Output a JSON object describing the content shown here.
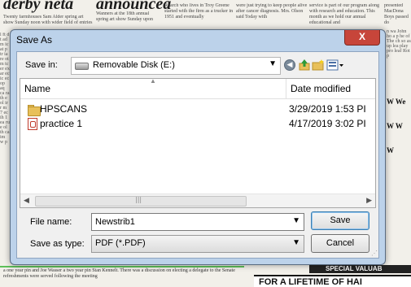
{
  "background": {
    "headline_1": "derby neta",
    "headline_2": "announcea",
    "bottom_ad": "FOR A LIFETIME OF HAI",
    "side_ad": "SPECIAL VALUAB"
  },
  "dialog": {
    "title": "Save As",
    "close_symbol": "X",
    "save_in": {
      "label": "Save in:",
      "value": "Removable Disk (E:)"
    },
    "toolbar": {
      "back_icon": "back-arrow-icon",
      "up_icon": "up-folder-icon",
      "new_folder_icon": "new-folder-icon",
      "view_icon": "view-menu-icon"
    },
    "file_list": {
      "columns": {
        "name": "Name",
        "date": "Date modified"
      },
      "rows": [
        {
          "name": "HPSCANS",
          "date": "3/29/2019 1:53 PI",
          "icon": "folder-icon"
        },
        {
          "name": "practice 1",
          "date": "4/17/2019 3:02 PI",
          "icon": "pdf-icon"
        }
      ]
    },
    "file_name": {
      "label": "File name:",
      "value": "Newstrib1"
    },
    "save_type": {
      "label": "Save as type:",
      "value": "PDF (*.PDF)"
    },
    "buttons": {
      "save": "Save",
      "cancel": "Cancel"
    },
    "colors": {
      "frame": "#bcd2ea",
      "close": "#c7453a"
    }
  }
}
